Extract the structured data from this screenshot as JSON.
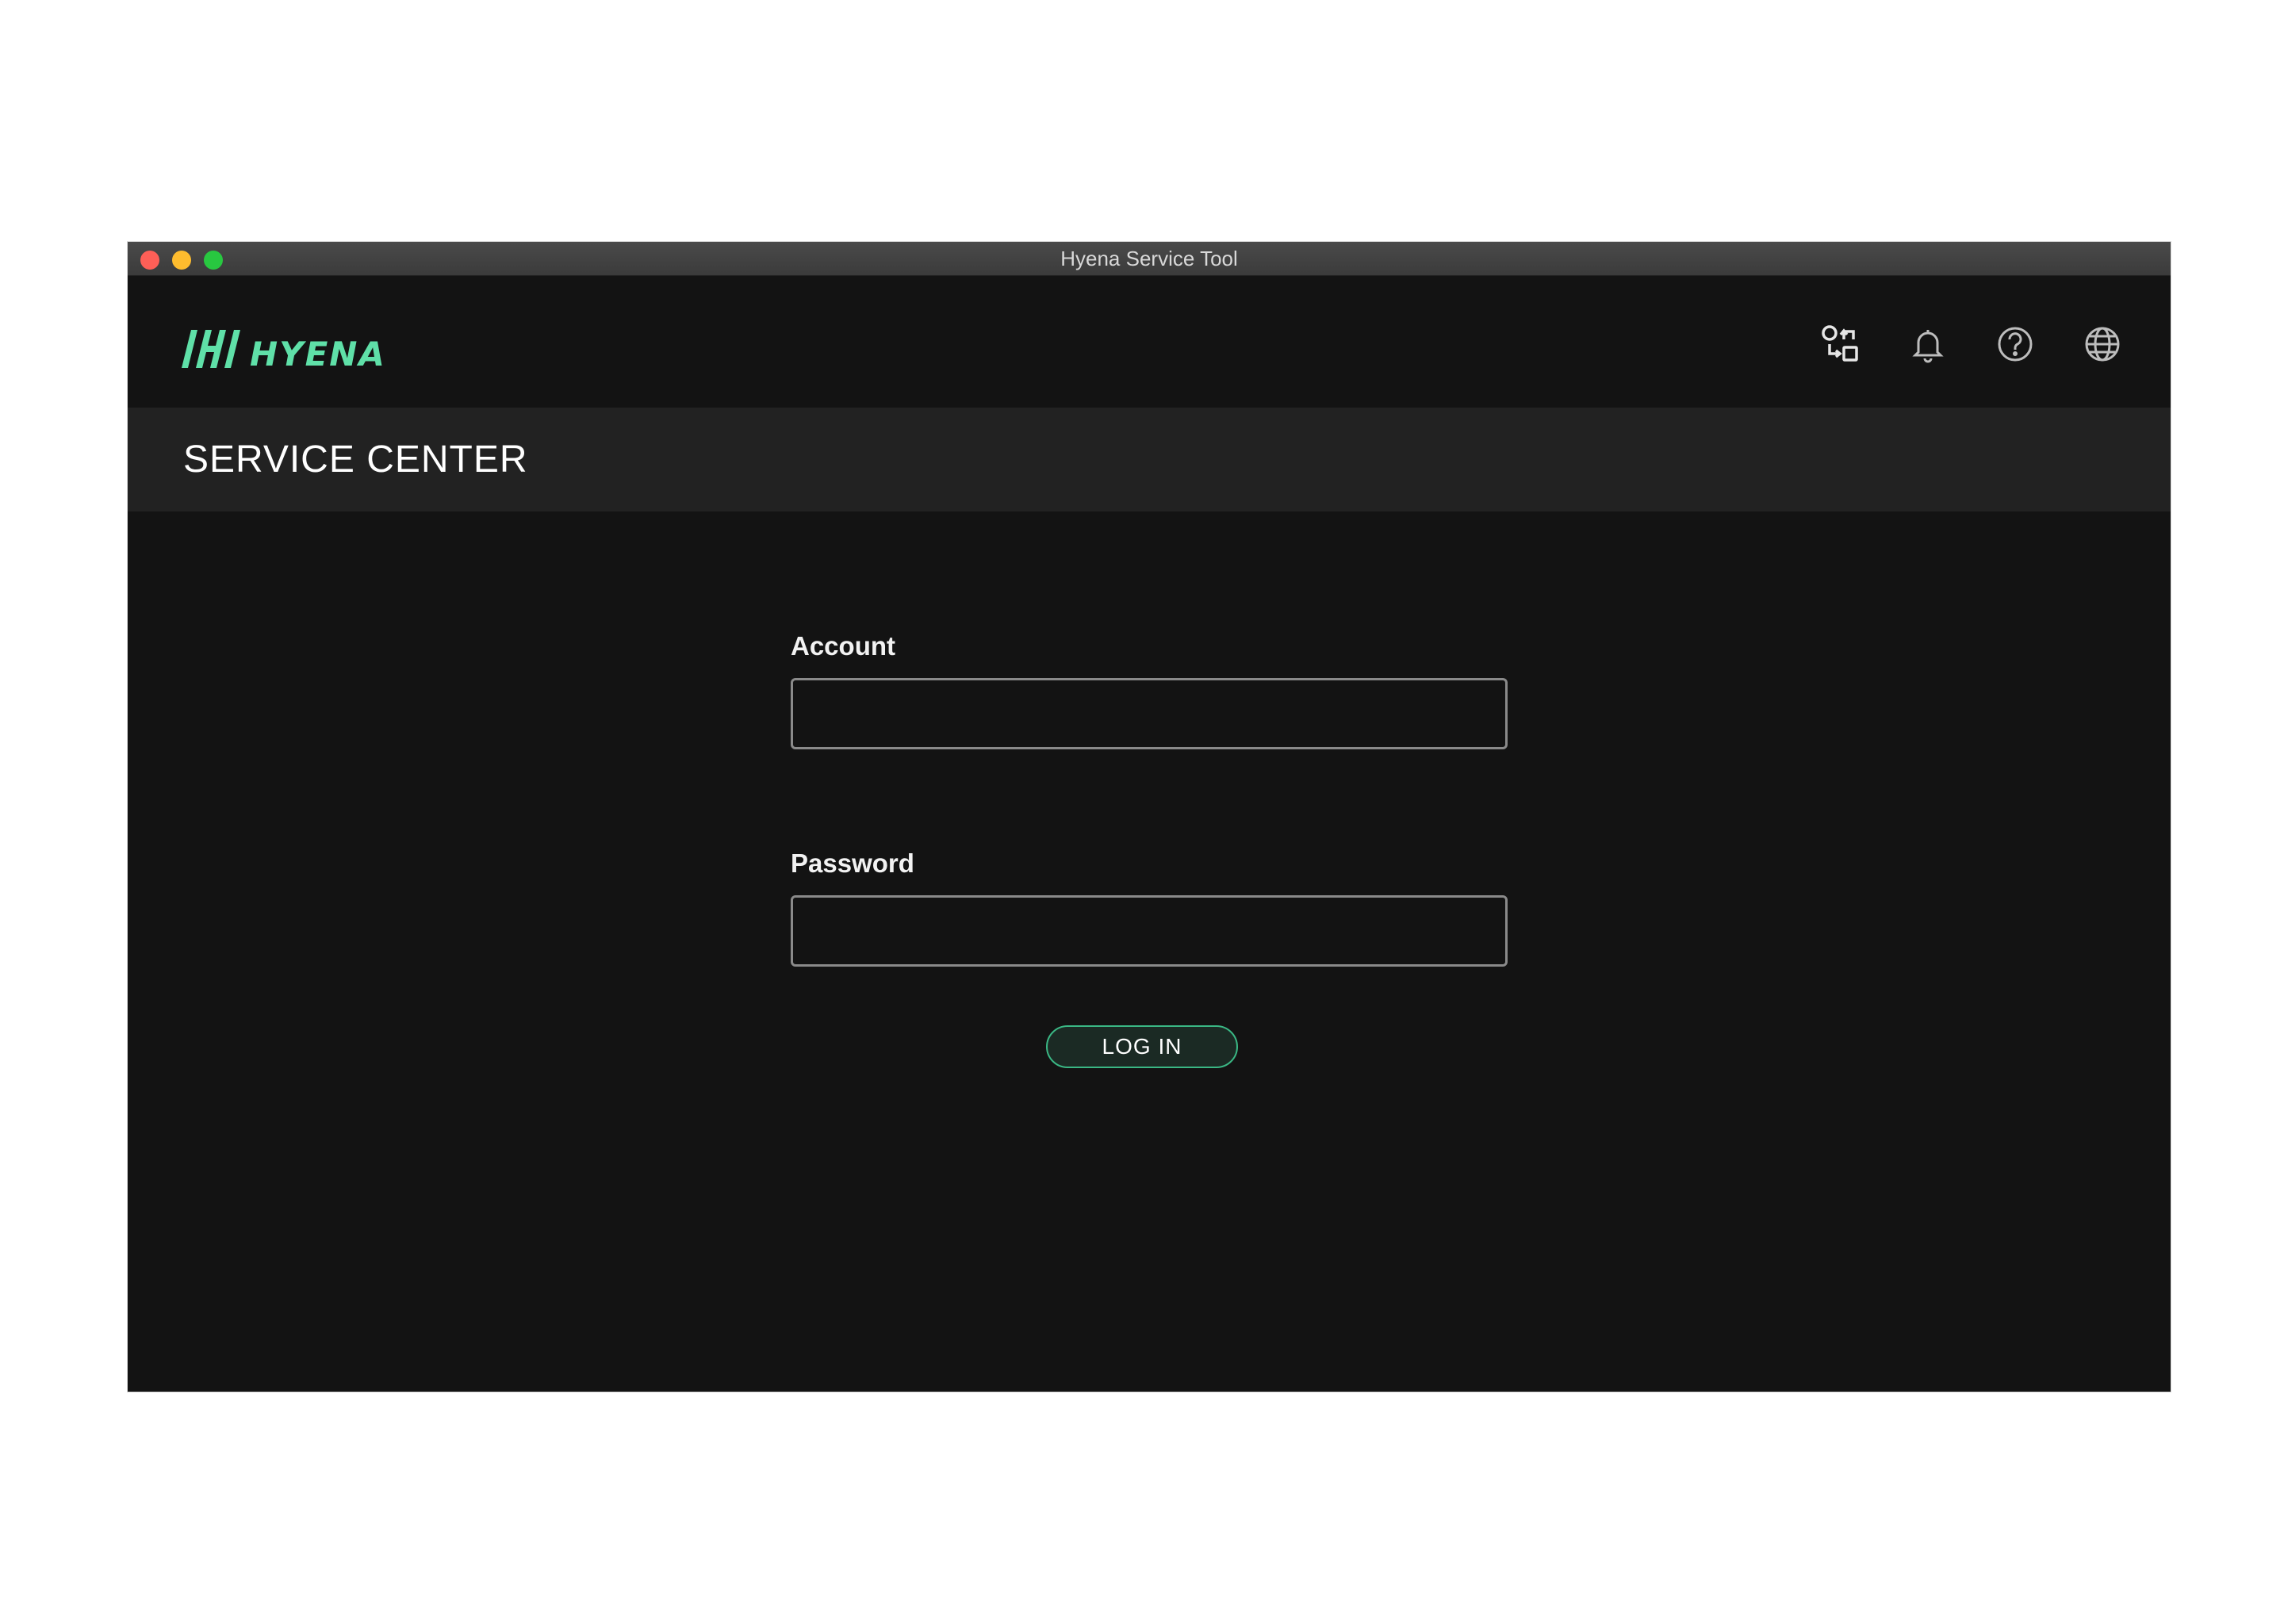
{
  "window": {
    "title": "Hyena Service Tool"
  },
  "brand": {
    "name": "HYENA",
    "color": "#5fe0a8"
  },
  "toolbar": {
    "icons": [
      "switch-device-icon",
      "bell-icon",
      "help-icon",
      "globe-icon"
    ]
  },
  "page": {
    "title": "SERVICE CENTER"
  },
  "form": {
    "account_label": "Account",
    "account_value": "",
    "password_label": "Password",
    "password_value": "",
    "login_label": "LOG IN",
    "accent_color": "#3ab784"
  }
}
